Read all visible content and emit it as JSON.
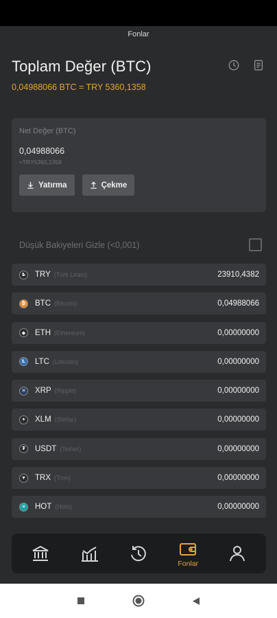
{
  "header": {
    "title": "Fonlar"
  },
  "summary": {
    "title": "Toplam Değer (BTC)",
    "value": "0,04988066 BTC = TRY 5360,1358",
    "history_icon": "history-icon",
    "report_icon": "document-icon"
  },
  "net_card": {
    "label": "Net Değer (BTC)",
    "amount": "0,04988066",
    "try_amount": "≈TRY5360,1358",
    "deposit_label": "Yatırma",
    "withdraw_label": "Çekme"
  },
  "hide_small": {
    "label": "Düşük Bakiyeleri Gizle (<0,001)",
    "checked": false
  },
  "assets": [
    {
      "symbol": "TRY",
      "name": "(Türk Lirası)",
      "balance": "23910,4382",
      "icon": "try-icon",
      "color": "#2a2b2d"
    },
    {
      "symbol": "BTC",
      "name": "(Bitcoin)",
      "balance": "0,04988066",
      "icon": "btc-icon",
      "color": "#e8892f"
    },
    {
      "symbol": "ETH",
      "name": "(Ethereum)",
      "balance": "0,00000000",
      "icon": "eth-icon",
      "color": "#2a2b2d"
    },
    {
      "symbol": "LTC",
      "name": "(Litecoin)",
      "balance": "0,00000000",
      "icon": "ltc-icon",
      "color": "#3a6fb0"
    },
    {
      "symbol": "XRP",
      "name": "(Ripple)",
      "balance": "0,00000000",
      "icon": "xrp-icon",
      "color": "#2d3f5c"
    },
    {
      "symbol": "XLM",
      "name": "(Stellar)",
      "balance": "0,00000000",
      "icon": "xlm-icon",
      "color": "#2a2b2d"
    },
    {
      "symbol": "USDT",
      "name": "(Tether)",
      "balance": "0,00000000",
      "icon": "usdt-icon",
      "color": "#2a2b2d"
    },
    {
      "symbol": "TRX",
      "name": "(Tron)",
      "balance": "0,00000000",
      "icon": "trx-icon",
      "color": "#2a2b2d"
    },
    {
      "symbol": "HOT",
      "name": "(Holo)",
      "balance": "0,00000000",
      "icon": "hot-icon",
      "color": "#1aa3a3"
    }
  ],
  "bottom_nav": {
    "items": [
      {
        "name": "bank-icon",
        "label": ""
      },
      {
        "name": "markets-icon",
        "label": ""
      },
      {
        "name": "trade-history-icon",
        "label": ""
      },
      {
        "name": "wallet-icon",
        "label": "Fonlar",
        "active": true
      },
      {
        "name": "profile-icon",
        "label": ""
      }
    ]
  },
  "colors": {
    "accent": "#e4a53a",
    "background": "#2a2b2d",
    "card": "#38393c"
  }
}
